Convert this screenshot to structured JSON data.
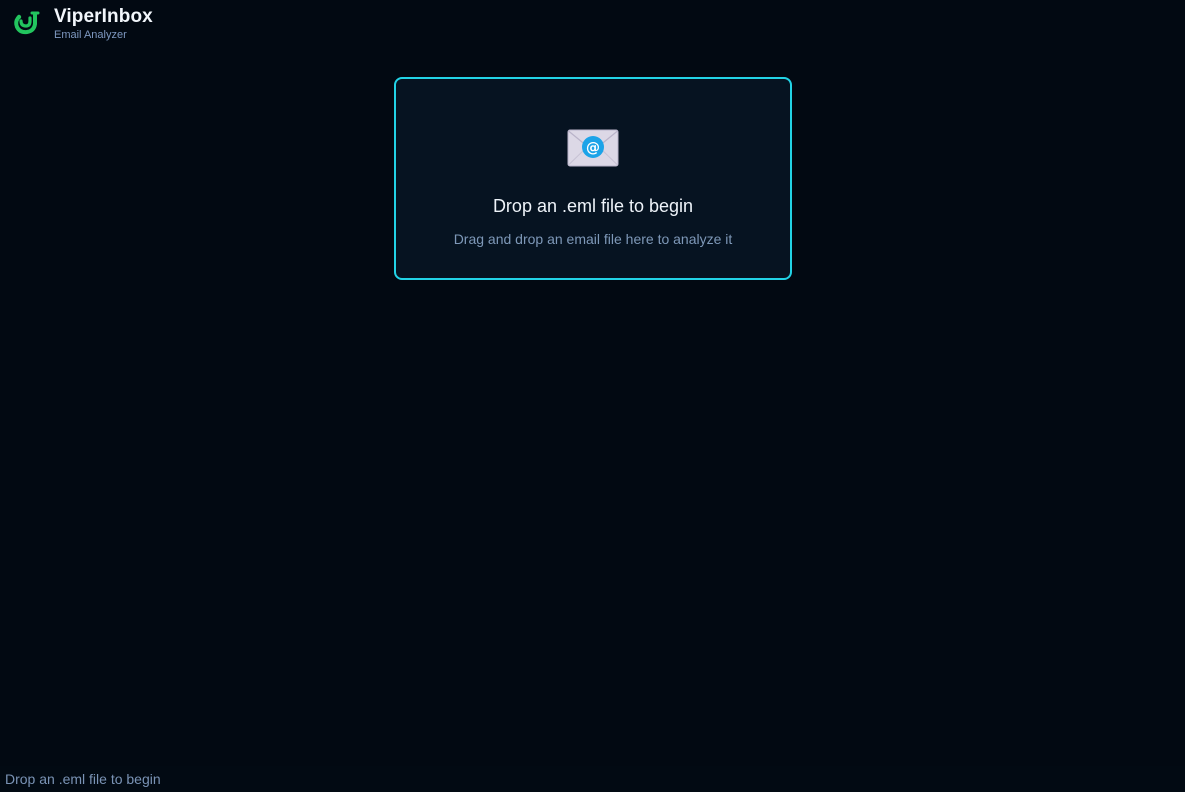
{
  "header": {
    "brand_name": "ViperInbox",
    "brand_subtitle": "Email Analyzer",
    "logo_icon": "viper-logo-icon"
  },
  "dropzone": {
    "icon": "envelope-at-icon",
    "title": "Drop an .eml file to begin",
    "subtitle": "Drag and drop an email file here to analyze it"
  },
  "statusbar": {
    "text": "Drop an .eml file to begin"
  },
  "colors": {
    "background": "#020912",
    "dropzone_border": "#22d3e6",
    "dropzone_fill": "#061321",
    "logo_green": "#22c55e",
    "muted_text": "#7e98b8"
  }
}
